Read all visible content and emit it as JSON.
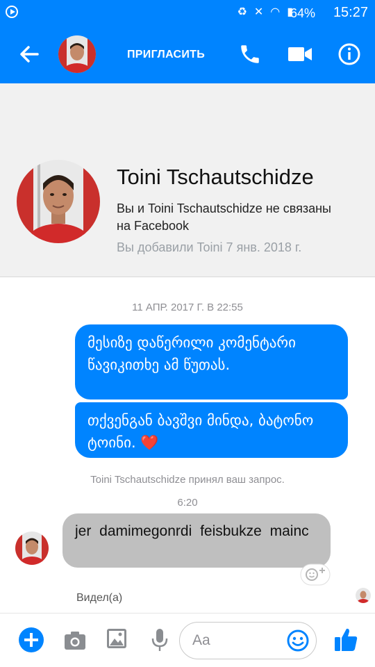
{
  "status_bar": {
    "battery": "64%",
    "time": "15:27"
  },
  "header": {
    "invite_label": "ПРИГЛАСИТЬ"
  },
  "profile": {
    "name": "Toini Tschautschidze",
    "not_connected": "Вы и Toini Tschautschidze не связаны на Facebook",
    "added": "Вы добавили Toini 7 янв. 2018 г."
  },
  "thread": {
    "date_header": "11 АПР. 2017 Г. В 22:55",
    "outgoing": [
      {
        "text": "მესიზე დაწერილი კომენტარი წავიკითხე ამ წუთას."
      },
      {
        "text": "თქვენგან ბავშვი მინდა, ბატონო ტოინი.",
        "emoji": "❤️"
      }
    ],
    "system_message": "Toini Tschautschidze принял ваш запрос.",
    "time_marker": "6:20",
    "incoming": [
      {
        "text": "jer damimegonrdi feisbukze mainc"
      }
    ],
    "seen_label": "Видел(а)"
  },
  "composer": {
    "placeholder": "Aa"
  },
  "colors": {
    "accent": "#0084ff",
    "incoming_bubble": "#bfbfbf",
    "heart": "#f02849"
  }
}
